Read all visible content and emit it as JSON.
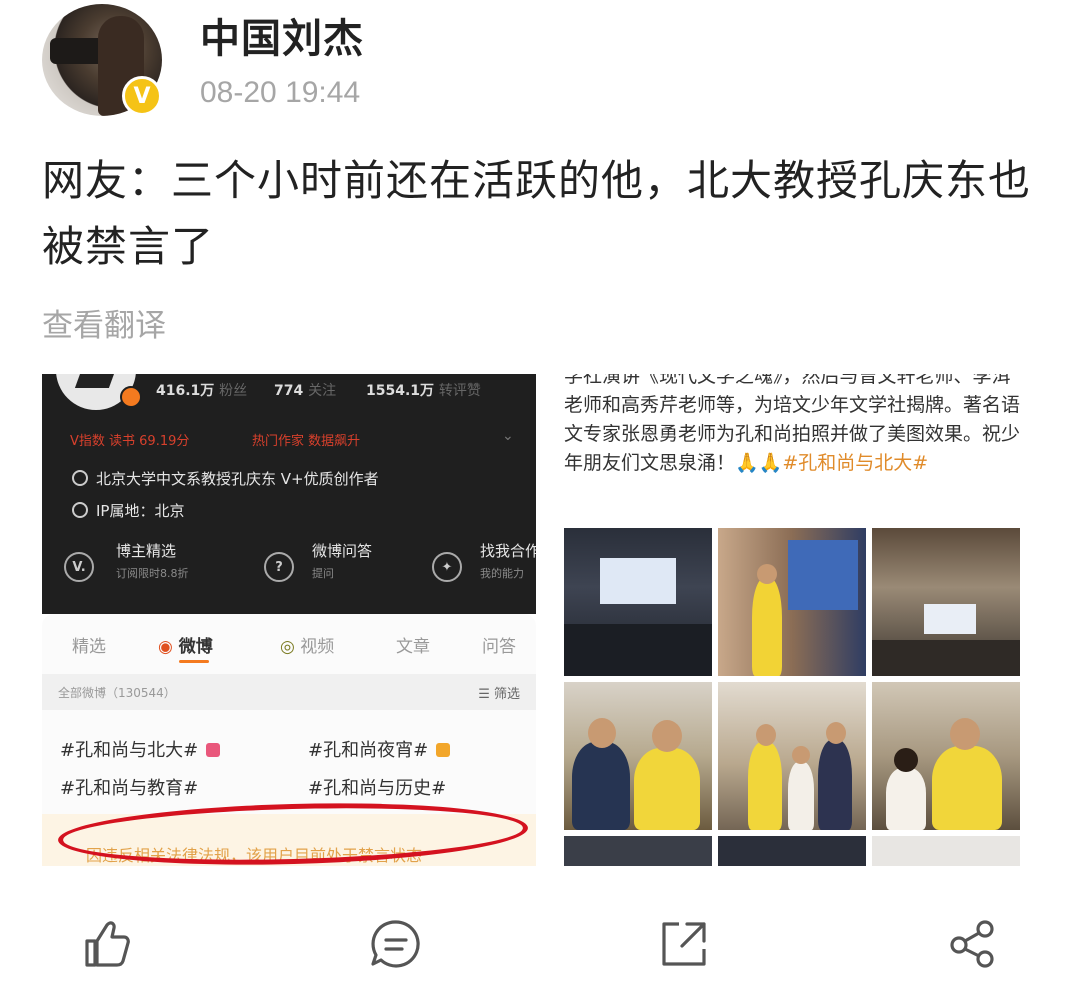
{
  "post": {
    "author": "中国刘杰",
    "timestamp": "08-20 19:44",
    "text": "网友：三个小时前还在活跃的他，北大教授孔庆东也被禁言了",
    "translate_label": "查看翻译"
  },
  "image1": {
    "stats": {
      "fans_count": "416.1万",
      "fans_label": "粉丝",
      "following_count": "774",
      "following_label": "关注",
      "reposts_count": "1554.1万",
      "reposts_label": "转评赞"
    },
    "v_index": "V指数 读书 69.19分",
    "hot_works": "热门作家 数据飙升",
    "verification": "北京大学中文系教授孔庆东 V+优质创作者",
    "ip_location": "IP属地：北京",
    "services": [
      {
        "title": "博主精选",
        "sub": "订阅限时8.8折"
      },
      {
        "title": "微博问答",
        "sub": "提问"
      },
      {
        "title": "找我合作",
        "sub": "我的能力"
      }
    ],
    "tabs": [
      "精选",
      "微博",
      "视频",
      "文章",
      "问答"
    ],
    "all_posts": "全部微博（130544）",
    "filter": "筛选",
    "tags": [
      "#孔和尚与北大#",
      "#孔和尚夜宵#",
      "#孔和尚与教育#",
      "#孔和尚与历史#"
    ],
    "ban_notice": "因违反相关法律法规，该用户目前处于禁言状态"
  },
  "image2": {
    "text": "学社演讲《现代文学之魂》，然后与曾文轩老师、李洱老师和高秀芹老师等，为培文少年文学社揭牌。著名语文专家张恩勇老师为孔和尚拍照并做了美图效果。祝少年朋友们文思泉涌！🙏🙏",
    "hashtag": "#孔和尚与北大#"
  },
  "toolbar": {
    "icons": [
      "like-icon",
      "comment-icon",
      "repost-icon",
      "share-icon"
    ]
  },
  "colors": {
    "accent_orange": "#f47a1f",
    "verified_gold": "#f5c316",
    "ring_red": "#d4121f",
    "muted_gray": "#a6a6a6"
  }
}
